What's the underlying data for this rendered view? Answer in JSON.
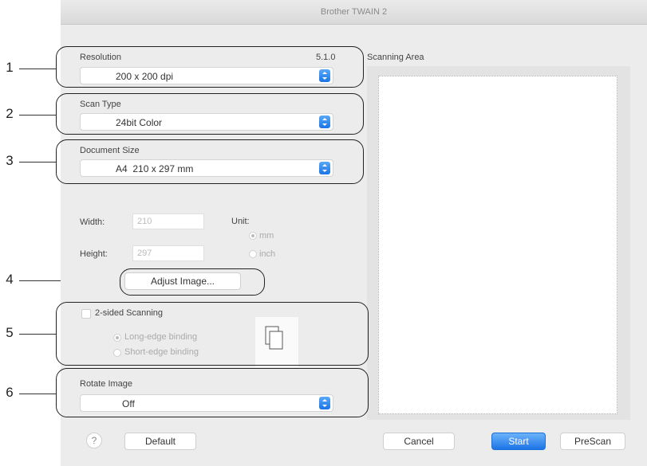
{
  "window": {
    "title": "Brother TWAIN 2"
  },
  "callouts": [
    "1",
    "2",
    "3",
    "4",
    "5",
    "6"
  ],
  "resolution": {
    "label": "Resolution",
    "version": "5.1.0",
    "value": "200 x 200 dpi"
  },
  "scan_type": {
    "label": "Scan Type",
    "value": "24bit Color"
  },
  "document_size": {
    "label": "Document Size",
    "value": "A4  210 x 297 mm"
  },
  "dimensions": {
    "width_label": "Width:",
    "width_value": "210",
    "height_label": "Height:",
    "height_value": "297",
    "unit_label": "Unit:",
    "unit_mm": "mm",
    "unit_inch": "inch",
    "unit_selected": "mm"
  },
  "adjust_image": {
    "label": "Adjust Image..."
  },
  "two_sided": {
    "label": "2-sided Scanning",
    "checked": false,
    "long_edge": "Long-edge binding",
    "short_edge": "Short-edge binding",
    "selected": "Long-edge binding"
  },
  "rotate": {
    "label": "Rotate Image",
    "value": "Off"
  },
  "scanning_area": {
    "label": "Scanning Area"
  },
  "buttons": {
    "help": "?",
    "default": "Default",
    "cancel": "Cancel",
    "start": "Start",
    "prescan": "PreScan"
  },
  "colors": {
    "accent": "#1d74e6"
  }
}
